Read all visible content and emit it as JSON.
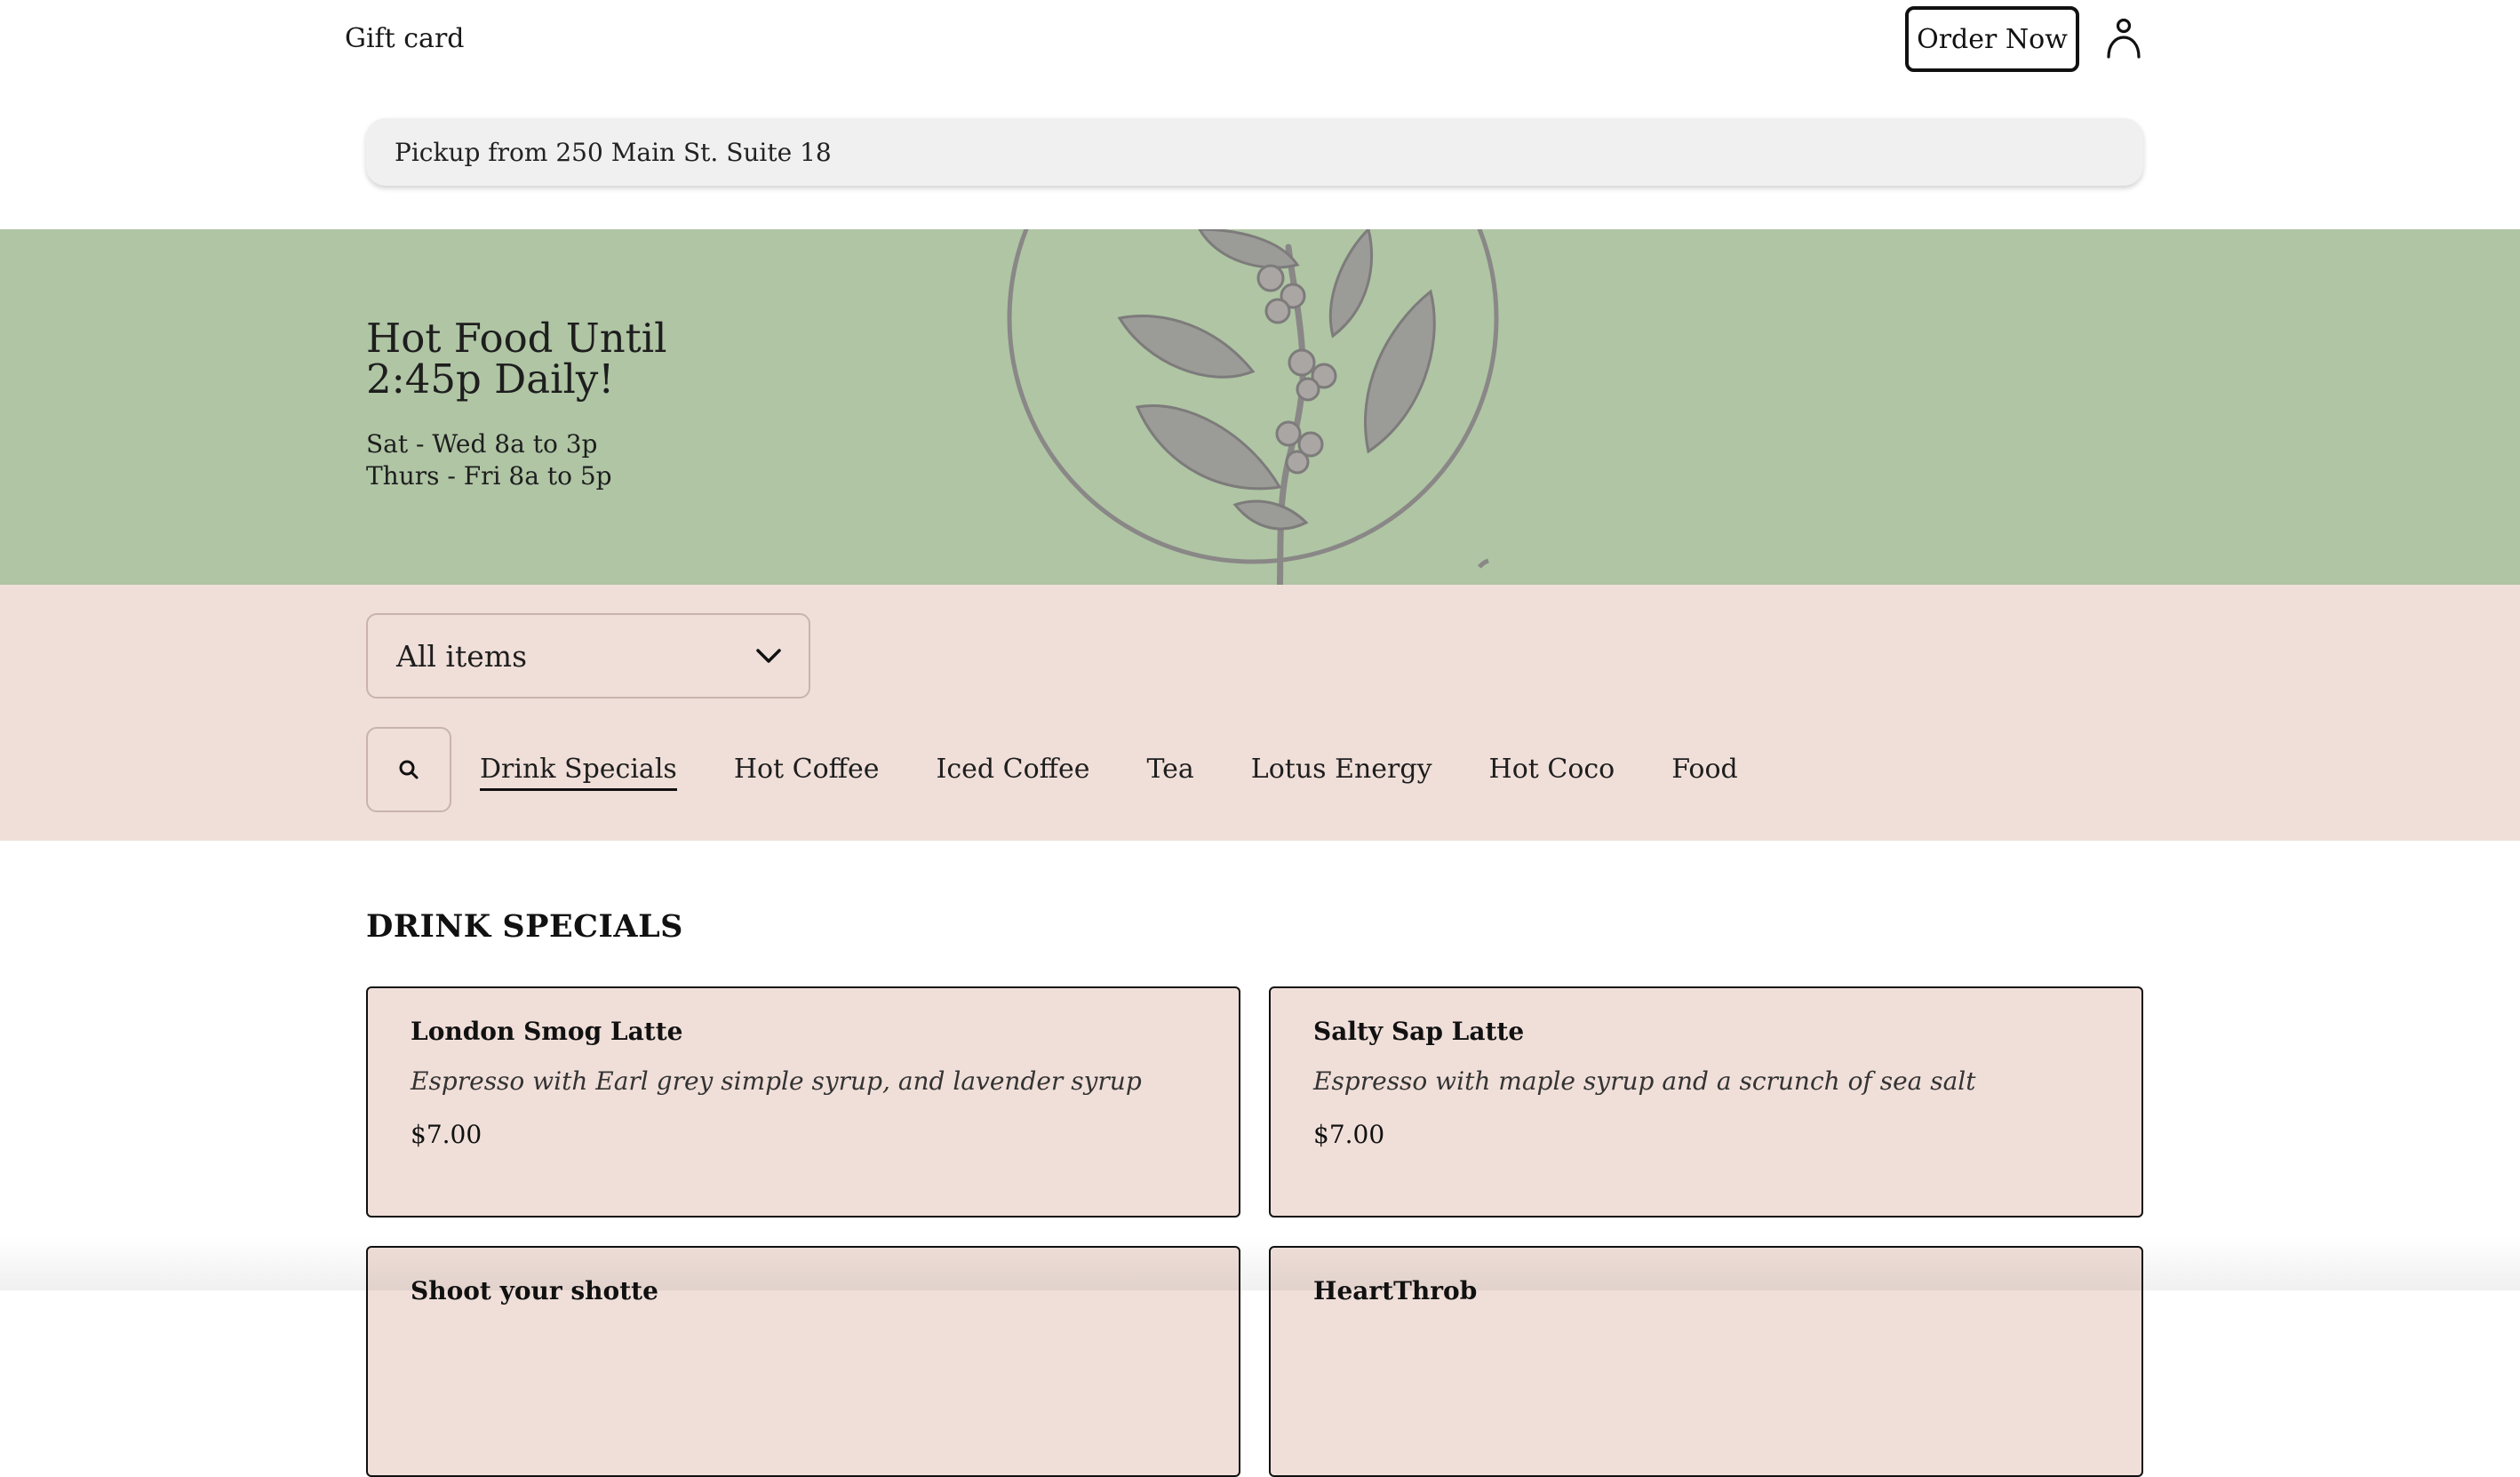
{
  "header": {
    "gift_card_label": "Gift card",
    "order_button_label": "Order Now",
    "account_icon": "person-icon"
  },
  "pickup": {
    "label": "Pickup from 250 Main St. Suite 18"
  },
  "hero": {
    "title_line1": "Hot Food Until",
    "title_line2": "2:45p Daily!",
    "hours_line1": "Sat - Wed 8a to 3p",
    "hours_line2": "Thurs - Fri 8a to 5p",
    "background_color": "#afc5a4",
    "art_icon": "coffee-plant-icon"
  },
  "filters": {
    "category_value": "All items",
    "category_icon": "chevron-down-icon",
    "search_icon": "search-icon",
    "tabs": [
      {
        "label": "Drink Specials",
        "active": true
      },
      {
        "label": "Hot Coffee",
        "active": false
      },
      {
        "label": "Iced Coffee",
        "active": false
      },
      {
        "label": "Tea",
        "active": false
      },
      {
        "label": "Lotus Energy",
        "active": false
      },
      {
        "label": "Hot Coco",
        "active": false
      },
      {
        "label": "Food",
        "active": false
      }
    ],
    "background_color": "#f0dfd9"
  },
  "menu": {
    "section_title": "DRINK SPECIALS",
    "items": [
      {
        "name": "London Smog Latte",
        "description": "Espresso with Earl grey simple syrup, and lavender syrup",
        "price": "$7.00"
      },
      {
        "name": "Salty Sap Latte",
        "description": "Espresso with maple syrup and a scrunch of sea salt",
        "price": "$7.00"
      },
      {
        "name": "Shoot your shotte",
        "description": "",
        "price": ""
      },
      {
        "name": "HeartThrob",
        "description": "",
        "price": ""
      }
    ]
  }
}
